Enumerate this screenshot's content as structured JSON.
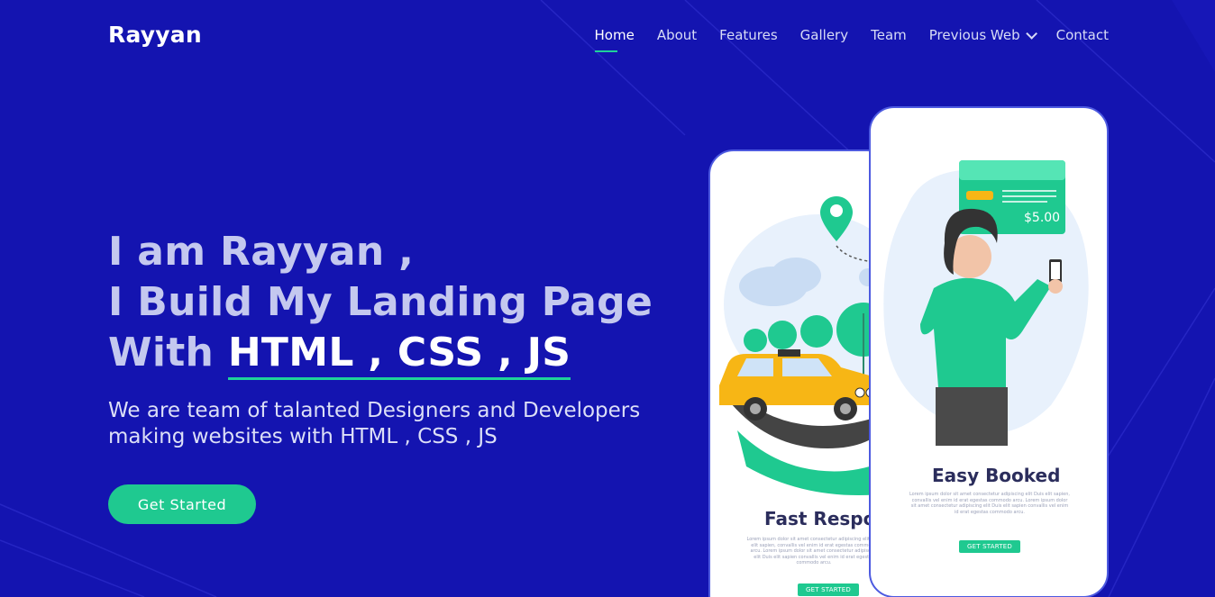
{
  "brand": {
    "logo": "Rayyan"
  },
  "nav": {
    "items": [
      {
        "label": "Home",
        "active": true
      },
      {
        "label": "About"
      },
      {
        "label": "Features"
      },
      {
        "label": "Gallery"
      },
      {
        "label": "Team"
      },
      {
        "label": "Previous Web",
        "dropdown": true
      },
      {
        "label": "Contact"
      }
    ]
  },
  "hero": {
    "line1": "I am Rayyan ,",
    "line2": "I Build My Landing Page",
    "line3_prefix": "With",
    "line3_highlight": "HTML , CSS , JS",
    "subtitle": "We are team of talanted Designers and Developers making websites with HTML , CSS , JS",
    "cta": "Get Started"
  },
  "phones": {
    "left": {
      "title": "Fast Respor",
      "lorem": "Lorem ipsum dolor sit amet consectetur adipiscing elit Duis elit sapien, convallis vel enim id erat egestas commodo arcu. Lorem ipsum dolor sit amet consectetur adipiscing elit Duis elit sapien convallis vel enim id erat egestas commodo arcu.",
      "button": "GET STARTED"
    },
    "right": {
      "title": "Easy Booked",
      "lorem": "Lorem ipsum dolor sit amet consectetur adipiscing elit Duis elit sapien, convallis vel enim id erat egestas commodo arcu. Lorem ipsum dolor sit amet consectetur adipiscing elit Duis elit sapien convallis vel enim id erat egestas commodo arcu.",
      "price": "$5.00",
      "button": "GET STARTED"
    }
  },
  "colors": {
    "background": "#1414b0",
    "accent": "#1fc990",
    "heading": "#c4c8ef"
  }
}
